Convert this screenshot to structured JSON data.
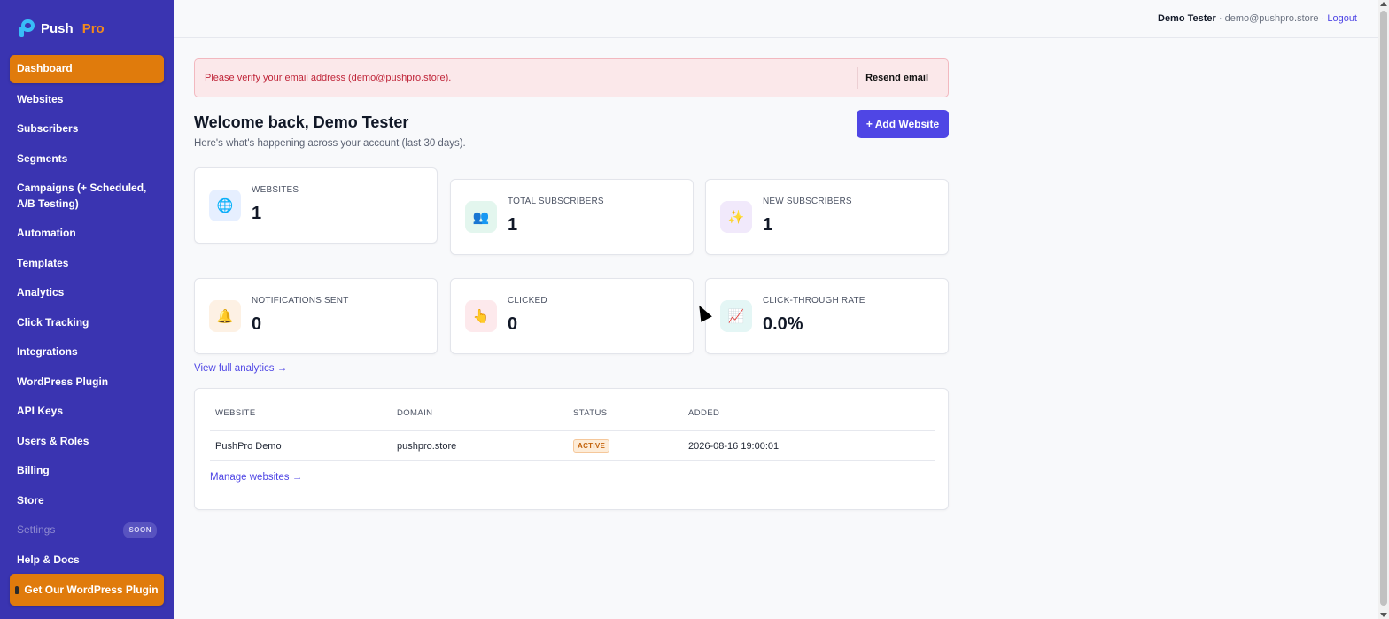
{
  "brand": {
    "name": "Push",
    "suffix": "Pro"
  },
  "sidebar": {
    "items": [
      {
        "label": "Dashboard"
      },
      {
        "label": "Websites"
      },
      {
        "label": "Subscribers"
      },
      {
        "label": "Segments"
      },
      {
        "label": "Campaigns (+ Scheduled, A/B Testing)"
      },
      {
        "label": "Automation"
      },
      {
        "label": "Templates"
      },
      {
        "label": "Analytics"
      },
      {
        "label": "Click Tracking"
      },
      {
        "label": "Integrations"
      },
      {
        "label": "WordPress Plugin"
      },
      {
        "label": "API Keys"
      },
      {
        "label": "Users & Roles"
      },
      {
        "label": "Billing"
      },
      {
        "label": "Store"
      },
      {
        "label": "Settings",
        "badge": "SOON"
      },
      {
        "label": "Help & Docs"
      }
    ],
    "cta_label": "Get Our WordPress Plugin"
  },
  "topbar": {
    "user_name": "Demo Tester",
    "separator1": " · ",
    "email": "demo@pushpro.store",
    "separator2": " · ",
    "logout_label": "Logout"
  },
  "alert": {
    "message": "Please verify your email address (demo@pushpro.store).",
    "button_label": "Resend email"
  },
  "header": {
    "title": "Welcome back, Demo Tester",
    "subtitle": "Here's what's happening across your account (last 30 days).",
    "add_button_label": "+ Add Website"
  },
  "stats": [
    {
      "label": "WEBSITES",
      "value": "1",
      "icon": "globe-icon",
      "icon_bg": "#e6efff"
    },
    {
      "label": "TOTAL SUBSCRIBERS",
      "value": "1",
      "icon": "users-icon",
      "icon_bg": "#e3f6ee"
    },
    {
      "label": "NEW SUBSCRIBERS",
      "value": "1",
      "icon": "sparkles-icon",
      "icon_bg": "#f1e9fb"
    },
    {
      "label": "NOTIFICATIONS SENT",
      "value": "0",
      "icon": "bell-icon",
      "icon_bg": "#fdf1e4"
    },
    {
      "label": "CLICKED",
      "value": "0",
      "icon": "pointer-hand-icon",
      "icon_bg": "#fde9ec"
    },
    {
      "label": "CLICK-THROUGH RATE",
      "value": "0.0%",
      "icon": "chart-up-icon",
      "icon_bg": "#e4f6f5"
    }
  ],
  "view_analytics_label": "View full analytics →",
  "websites_table": {
    "headers": [
      "WEBSITE",
      "DOMAIN",
      "STATUS",
      "ADDED"
    ],
    "rows": [
      {
        "website": "PushPro Demo",
        "domain": "pushpro.store",
        "status": "ACTIVE",
        "added": "2026-08-16 19:00:01"
      }
    ],
    "manage_label": "Manage websites →"
  },
  "colors": {
    "sidebar_bg": "#3a34b1",
    "accent_orange": "#e07b0c",
    "primary": "#4f46e5",
    "alert_bg": "#fbe8ea",
    "alert_text": "#c0263a"
  }
}
